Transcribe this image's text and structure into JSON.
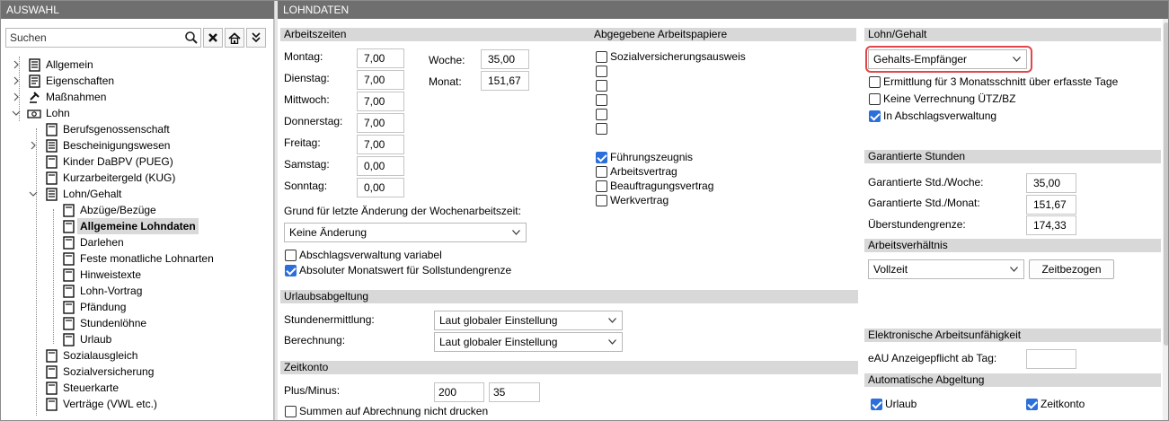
{
  "left": {
    "header": "AUSWAHL",
    "search_placeholder": "Suchen",
    "tree": [
      {
        "label": "Allgemein"
      },
      {
        "label": "Eigenschaften"
      },
      {
        "label": "Maßnahmen"
      },
      {
        "label": "Lohn"
      },
      {
        "label": "Berufsgenossenschaft"
      },
      {
        "label": "Bescheinigungswesen"
      },
      {
        "label": "Kinder DaBPV (PUEG)"
      },
      {
        "label": "Kurzarbeitergeld (KUG)"
      },
      {
        "label": "Lohn/Gehalt"
      },
      {
        "label": "Abzüge/Bezüge"
      },
      {
        "label": "Allgemeine Lohndaten"
      },
      {
        "label": "Darlehen"
      },
      {
        "label": "Feste monatliche Lohnarten"
      },
      {
        "label": "Hinweistexte"
      },
      {
        "label": "Lohn-Vortrag"
      },
      {
        "label": "Pfändung"
      },
      {
        "label": "Stundenlöhne"
      },
      {
        "label": "Urlaub"
      },
      {
        "label": "Sozialausgleich"
      },
      {
        "label": "Sozialversicherung"
      },
      {
        "label": "Steuerkarte"
      },
      {
        "label": "Verträge (VWL etc.)"
      }
    ]
  },
  "right": {
    "header": "LOHNDATEN",
    "arbeitszeiten": {
      "title": "Arbeitszeiten",
      "days": [
        {
          "label": "Montag:",
          "value": "7,00"
        },
        {
          "label": "Dienstag:",
          "value": "7,00"
        },
        {
          "label": "Mittwoch:",
          "value": "7,00"
        },
        {
          "label": "Donnerstag:",
          "value": "7,00"
        },
        {
          "label": "Freitag:",
          "value": "7,00"
        },
        {
          "label": "Samstag:",
          "value": "0,00"
        },
        {
          "label": "Sonntag:",
          "value": "0,00"
        }
      ],
      "woche_label": "Woche:",
      "woche_value": "35,00",
      "monat_label": "Monat:",
      "monat_value": "151,67",
      "grund_label": "Grund für letzte Änderung der Wochenarbeitszeit:",
      "grund_value": "Keine Änderung",
      "cb_abschlag": "Abschlagsverwaltung variabel",
      "cb_absolut": "Absoluter Monatswert für Sollstundengrenze"
    },
    "urlaub": {
      "title": "Urlaubsabgeltung",
      "stunden_label": "Stundenermittlung:",
      "stunden_value": "Laut globaler Einstellung",
      "berechnung_label": "Berechnung:",
      "berechnung_value": "Laut globaler Einstellung"
    },
    "zeitkonto": {
      "title": "Zeitkonto",
      "plus_label": "Plus/Minus:",
      "plus_value1": "200",
      "plus_value2": "35",
      "cb_summen": "Summen auf Abrechnung nicht drucken"
    },
    "papiere": {
      "title": "Abgegebene Arbeitspapiere",
      "sv": "Sozialversicherungsausweis",
      "fz": "Führungszeugnis",
      "av": "Arbeitsvertrag",
      "bv": "Beauftragungsvertrag",
      "wv": "Werkvertrag"
    },
    "lohn_gehalt": {
      "title": "Lohn/Gehalt",
      "select_value": "Gehalts-Empfänger",
      "cb_ermittlung": "Ermittlung für 3 Monatsschnitt über erfasste Tage",
      "cb_keine": "Keine Verrechnung ÜTZ/BZ",
      "cb_abschlag": "In Abschlagsverwaltung"
    },
    "garantiert": {
      "title": "Garantierte Stunden",
      "woche_label": "Garantierte Std./Woche:",
      "woche_value": "35,00",
      "monat_label": "Garantierte Std./Monat:",
      "monat_value": "151,67",
      "ueber_label": "Überstundengrenze:",
      "ueber_value": "174,33"
    },
    "arbeitsverhaeltnis": {
      "title": "Arbeitsverhältnis",
      "select_value": "Vollzeit",
      "button": "Zeitbezogen"
    },
    "eau": {
      "title": "Elektronische Arbeitsunfähigkeit",
      "label": "eAU Anzeigepflicht ab Tag:",
      "value": ""
    },
    "auto": {
      "title": "Automatische Abgeltung",
      "urlaub": "Urlaub",
      "zeitkonto": "Zeitkonto"
    }
  }
}
